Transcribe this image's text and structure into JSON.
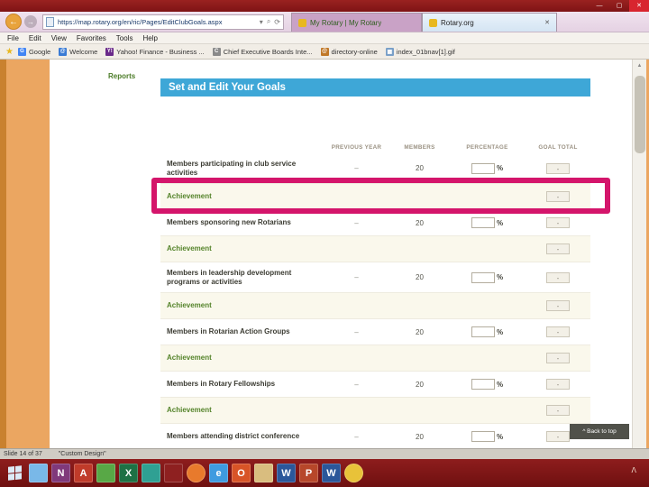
{
  "icons": {
    "minimize": "—",
    "maximize": "▢",
    "close": "✕",
    "back": "←",
    "forward": "→",
    "dropdown": "▾",
    "search": "⌕",
    "refresh": "⟳",
    "tab_close": "✕",
    "star": "★",
    "scroll_up": "▲",
    "tray_up": "ᐱ"
  },
  "browser": {
    "url": "https://map.rotary.org/en/ric/Pages/EditClubGoals.aspx",
    "tabs": [
      {
        "label": "My Rotary | My Rotary",
        "active": true
      },
      {
        "label": "Rotary.org",
        "active": false
      }
    ],
    "menu": [
      "File",
      "Edit",
      "View",
      "Favorites",
      "Tools",
      "Help"
    ],
    "favorites": [
      {
        "label": "Google",
        "icon": "G",
        "color": "#4285f4"
      },
      {
        "label": "Welcome",
        "icon": "@",
        "color": "#3a7bd5"
      },
      {
        "label": "Yahoo! Finance - Business ...",
        "icon": "Y!",
        "color": "#6a2a8a"
      },
      {
        "label": "Chief Executive Boards Inte...",
        "icon": "C",
        "color": "#8a8a8a"
      },
      {
        "label": "directory-online",
        "icon": "@",
        "color": "#c07828"
      },
      {
        "label": "index_01bnav[1].gif",
        "icon": "▦",
        "color": "#7aa0c8"
      }
    ]
  },
  "page": {
    "reports_label": "Reports",
    "title": "Set and Edit Your Goals",
    "columns": [
      "PREVIOUS YEAR",
      "MEMBERS",
      "PERCENTAGE",
      "GOAL TOTAL"
    ],
    "rows": [
      {
        "type": "goal",
        "label": "Members participating in club service activities",
        "previous_year": "–",
        "members": "20",
        "percent_sign": "%",
        "goal_total": "-",
        "tall": true
      },
      {
        "type": "achievement",
        "label": "Achievement",
        "goal_total": "-",
        "highlighted": true
      },
      {
        "type": "goal",
        "label": "Members sponsoring new Rotarians",
        "previous_year": "–",
        "members": "20",
        "percent_sign": "%",
        "goal_total": "-"
      },
      {
        "type": "achievement",
        "label": "Achievement",
        "goal_total": "-"
      },
      {
        "type": "goal",
        "label": "Members in leadership development programs or activities",
        "previous_year": "–",
        "members": "20",
        "percent_sign": "%",
        "goal_total": "-",
        "tall": true
      },
      {
        "type": "achievement",
        "label": "Achievement",
        "goal_total": "-"
      },
      {
        "type": "goal",
        "label": "Members in Rotarian Action Groups",
        "previous_year": "–",
        "members": "20",
        "percent_sign": "%",
        "goal_total": "-"
      },
      {
        "type": "achievement",
        "label": "Achievement",
        "goal_total": "-"
      },
      {
        "type": "goal",
        "label": "Members in Rotary Fellowships",
        "previous_year": "–",
        "members": "20",
        "percent_sign": "%",
        "goal_total": "-"
      },
      {
        "type": "achievement",
        "label": "Achievement",
        "goal_total": "-"
      },
      {
        "type": "goal",
        "label": "Members attending district conference",
        "previous_year": "–",
        "members": "20",
        "percent_sign": "%",
        "goal_total": "-"
      }
    ],
    "back_to_top": "^ Back to top"
  },
  "statusbar": {
    "slide": "Slide 14 of 37",
    "design": "\"Custom Design\""
  },
  "taskbar": {
    "apps": [
      {
        "letter": "",
        "color": "#79b8e8",
        "round": false
      },
      {
        "letter": "N",
        "color": "#80397b",
        "round": false
      },
      {
        "letter": "A",
        "color": "#c03b2a",
        "round": false
      },
      {
        "letter": "",
        "color": "#58a846",
        "round": false
      },
      {
        "letter": "X",
        "color": "#1e7145",
        "round": false
      },
      {
        "letter": "",
        "color": "#2fa093",
        "round": false
      },
      {
        "letter": "",
        "color": "#8e2020",
        "round": false
      },
      {
        "letter": "",
        "color": "#e87a2c",
        "round": true
      },
      {
        "letter": "e",
        "color": "#3f9be0",
        "round": false
      },
      {
        "letter": "O",
        "color": "#d85427",
        "round": false
      },
      {
        "letter": "",
        "color": "#d9bd7f",
        "round": false
      },
      {
        "letter": "W",
        "color": "#2b579a",
        "round": false
      },
      {
        "letter": "P",
        "color": "#b7472a",
        "round": false
      },
      {
        "letter": "W",
        "color": "#2b579a",
        "round": false
      },
      {
        "letter": "",
        "color": "#e8c239",
        "round": true
      }
    ]
  }
}
